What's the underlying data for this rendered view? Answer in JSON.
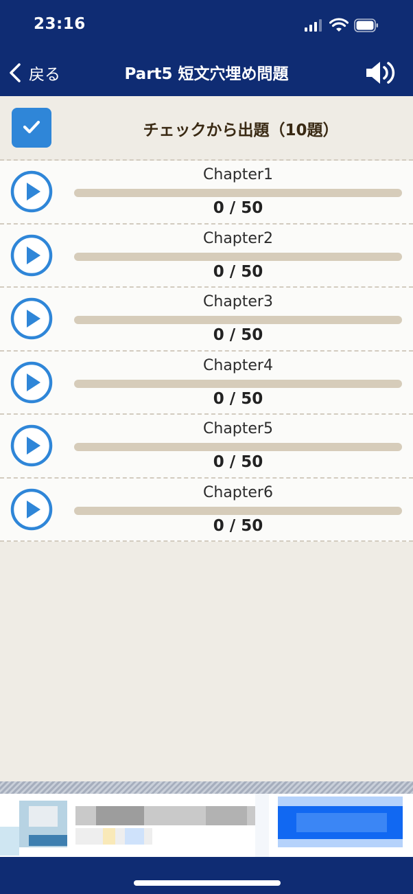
{
  "status_bar": {
    "time": "23:16"
  },
  "nav": {
    "back_label": "戻る",
    "title": "Part5 短文穴埋め問題"
  },
  "check_bar": {
    "checked": true,
    "label": "チェックから出題（10題）"
  },
  "chapters": [
    {
      "name": "Chapter1",
      "score": "0 / 50",
      "progress": 0
    },
    {
      "name": "Chapter2",
      "score": "0 / 50",
      "progress": 0
    },
    {
      "name": "Chapter3",
      "score": "0 / 50",
      "progress": 0
    },
    {
      "name": "Chapter4",
      "score": "0 / 50",
      "progress": 0
    },
    {
      "name": "Chapter5",
      "score": "0 / 50",
      "progress": 0
    },
    {
      "name": "Chapter6",
      "score": "0 / 50",
      "progress": 0
    }
  ],
  "colors": {
    "header": "#0f2c73",
    "accent": "#2f86d8",
    "background": "#efece5",
    "progress_track": "#d6ccba"
  },
  "icons": {
    "back": "chevron-left-icon",
    "sound": "speaker-icon",
    "check": "checkmark-icon",
    "play": "play-circle-icon"
  }
}
